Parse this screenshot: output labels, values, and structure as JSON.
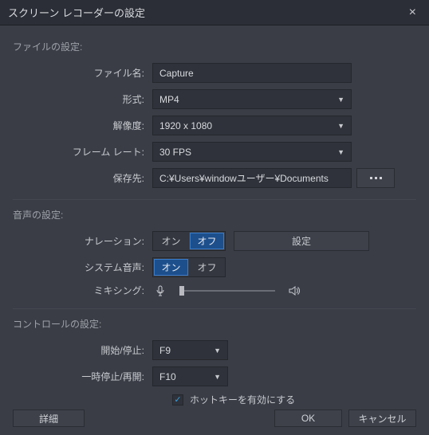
{
  "title": "スクリーン レコーダーの設定",
  "sections": {
    "file": {
      "label": "ファイルの設定:",
      "filename_label": "ファイル名:",
      "filename_value": "Capture",
      "format_label": "形式:",
      "format_value": "MP4",
      "resolution_label": "解像度:",
      "resolution_value": "1920 x 1080",
      "framerate_label": "フレーム レート:",
      "framerate_value": "30 FPS",
      "savepath_label": "保存先:",
      "savepath_value": "C:¥Users¥windowユーザー¥Documents"
    },
    "audio": {
      "label": "音声の設定:",
      "narration_label": "ナレーション:",
      "narration_on": "オン",
      "narration_off": "オフ",
      "narration_settings": "設定",
      "system_label": "システム音声:",
      "system_on": "オン",
      "system_off": "オフ",
      "mixing_label": "ミキシング:"
    },
    "control": {
      "label": "コントロールの設定:",
      "startstop_label": "開始/停止:",
      "startstop_value": "F9",
      "pause_label": "一時停止/再開:",
      "pause_value": "F10",
      "hotkey_label": "ホットキーを有効にする",
      "hotkey_checked": true
    }
  },
  "footer": {
    "detail": "詳細",
    "ok": "OK",
    "cancel": "キャンセル"
  }
}
